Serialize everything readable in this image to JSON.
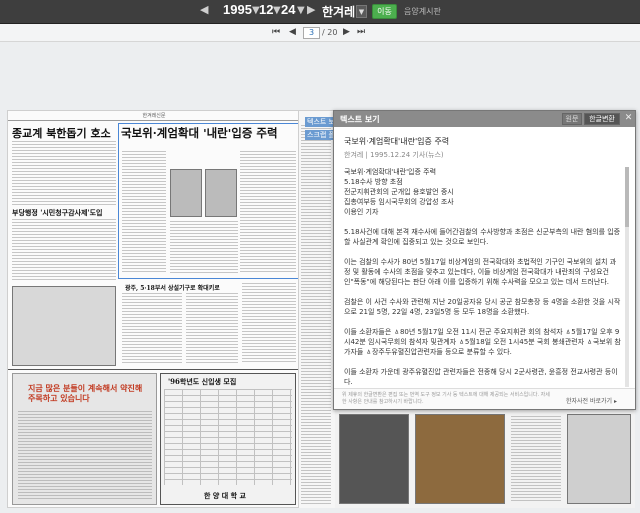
{
  "topbar": {
    "year": "1995",
    "month": "12",
    "day": "24",
    "unit": "▼",
    "newspaper": "한겨레",
    "dropdown": "▼",
    "go_label": "이동",
    "related_label": "음양계시판"
  },
  "pagination": {
    "current": "3",
    "total": "/ 20"
  },
  "newspaper_page": {
    "masthead": "한겨레신문",
    "headline_main": "국보위·계엄확대 '내란'입증 주력",
    "headline_left": "종교계 북한돕기 호소",
    "headline_left2": "부당행정 '시민청구감사제'도입",
    "headline_mid": "광주, 5·18부서 상설기구로 확대키로",
    "headline_box": "지금 많은 분들이 계속해서 약진해 주목하고 있습니다",
    "headline_ad": "'96학년도 신입생 모집",
    "ad_school": "한 양 대 학 교",
    "peek_tab1": "텍스트 보",
    "peek_tab2": "스크랩 폴"
  },
  "text_panel": {
    "title": "텍스트 보기",
    "original_label": "원문",
    "convert_label": "한글변환",
    "close_label": "✕",
    "article_title": "국보위·계엄확대'내란'입증 주력",
    "byline": "한겨레 | 1995.12.24 기사(뉴스)",
    "paragraphs": [
      "국보위·계엄확대'내란'입증 주력\n5.18수사 방향 초점\n전군지휘관회의 군개입 용호발언 중시\n집총여부등 임시국무회의 강압성 조사\n이용인 기자",
      "5.18사건에 대해 본격 재수사에 들어간검찰의 수사방향과 초점은 신군부측의 내란 혐의를 입증할 사실관계 확인에 집중되고 있는 것으로 보인다.",
      "이는 검찰의 수사가 80년 5월17일 비상계엄의 전국확대와 초법적인 기구인 국보위의 설치 과정 및 활동에 수사의 초점을 맞추고 있는데다, 이들 비상계엄 전국확대가 내란죄의 구성요건인\"폭동\"에 해당된다는 판단 아래 이를 입증하기 위해 수사력을 모으고 있는 데서 드러난다.",
      "검찰은 이 사건 수사와 관련해 지난 20일공자유 당시 공군 참모총장 등 4명을 소환한 것을 시작으로 21일 5명, 22일 4명, 23일5명 등 모두 18명을 소환했다.",
      "이들 소환자들은 ㅿ80년 5월17일 오전 11시 전군 주요지휘관 회의 참석자 ㅿ5월17일 오후 9시42분 임시국무회의 참석자 및관계자 ㅿ5월18일 오전 1시45분 국회 봉쇄관련자 ㅿ국보위 참가자들 ㅿ장주두유혈진압관련자들 등으로 분류할 수 있다.",
      "이들 소환자 가운데 광주유혈진압 관련자들은 전종해 당시 2군사령관, 윤흥정 전교사령관 등이다."
    ],
    "footer_note": "위 제휴의 한글변환은 편집 또는 번역 도구 정보 기사 등 텍스트에 대해 제공되는 서비스입니다. 자세한 사항은 안내를 참고하시기 바랍니다.",
    "footer_link": "한자사전 바로가기 ▸"
  }
}
